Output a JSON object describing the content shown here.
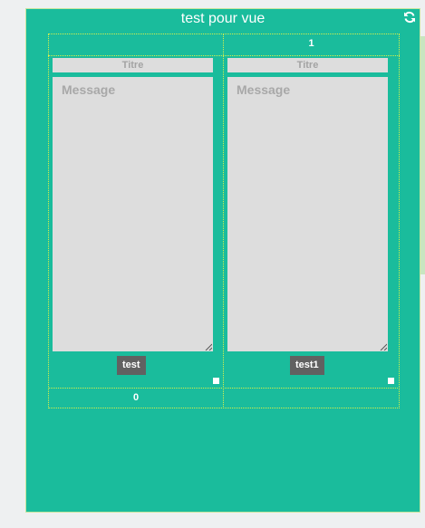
{
  "panel": {
    "title": "test pour vue",
    "refresh_icon": "refresh-icon"
  },
  "grid": {
    "column_index": "1",
    "row_index": "0",
    "cells": [
      {
        "titre_placeholder": "Titre",
        "message_placeholder": "Message",
        "button_label": "test"
      },
      {
        "titre_placeholder": "Titre",
        "message_placeholder": "Message",
        "button_label": "test1"
      }
    ]
  },
  "colors": {
    "panel_bg": "#1abc9c",
    "input_bg": "#dddddd",
    "button_bg": "#616161",
    "grid_line": "#d6f04a"
  }
}
